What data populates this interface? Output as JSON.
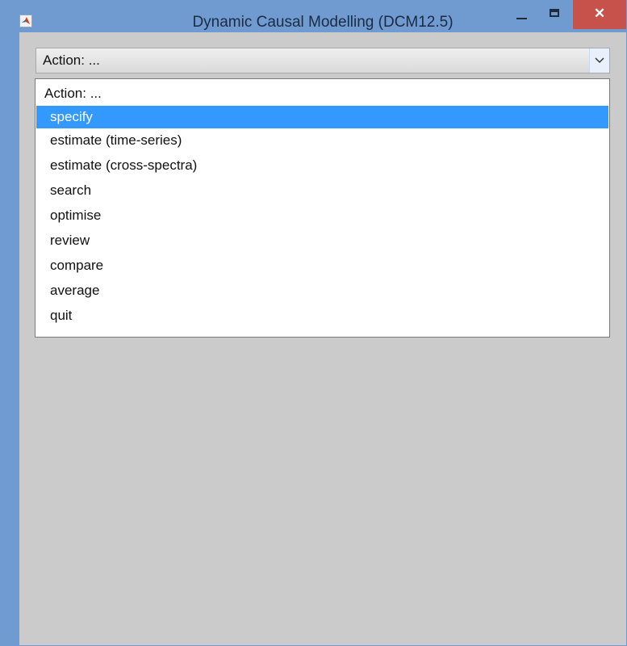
{
  "window": {
    "title": "Dynamic Causal Modelling (DCM12.5)",
    "close_glyph": "✕"
  },
  "select": {
    "current_value": "Action: ..."
  },
  "dropdown": {
    "items": [
      {
        "label": "Action: ..."
      },
      {
        "label": "specify",
        "selected": true
      },
      {
        "label": "estimate (time-series)"
      },
      {
        "label": "estimate (cross-spectra)"
      },
      {
        "label": "search"
      },
      {
        "label": "optimise"
      },
      {
        "label": "review"
      },
      {
        "label": "compare"
      },
      {
        "label": "average"
      },
      {
        "label": "quit"
      }
    ]
  },
  "colors": {
    "titlebar": "#6f9bd0",
    "close_button": "#c7514b",
    "client_background": "#cbcbcb",
    "selection": "#3399ff"
  },
  "icons": {
    "app": "matlab-logo-icon",
    "minimize": "minimize-icon",
    "maximize": "maximize-icon",
    "close": "close-icon",
    "dropdown": "chevron-down-icon"
  }
}
